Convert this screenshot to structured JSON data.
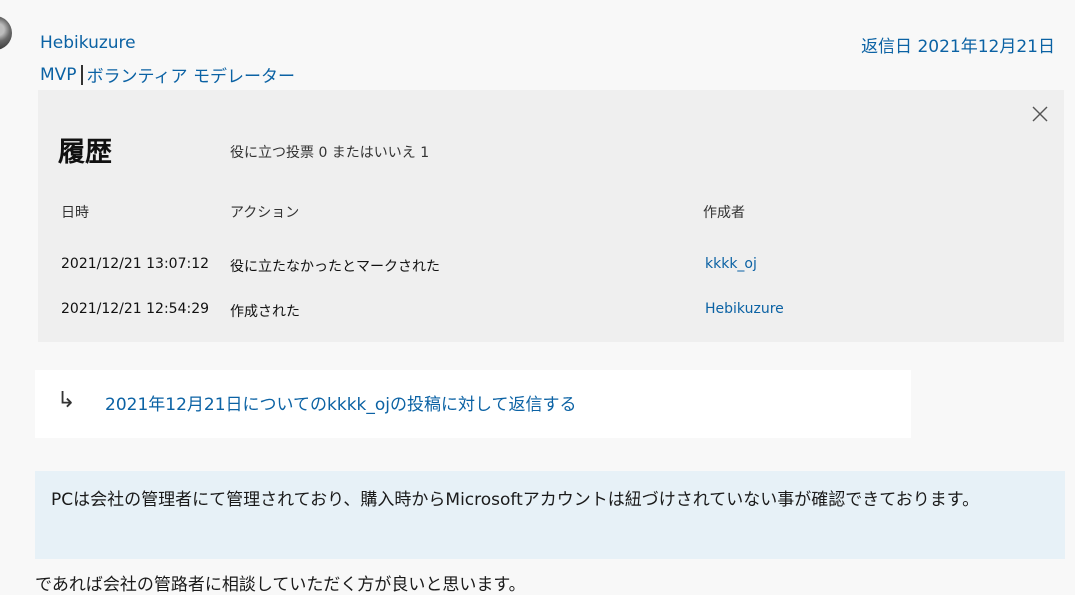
{
  "author": {
    "name": "Hebikuzure",
    "role_prefix": "MVP",
    "role": "ボランティア モデレーター"
  },
  "reply_date": "返信日 2021年12月21日",
  "history": {
    "title": "履歴",
    "votes_summary": "役に立つ投票 0 またはいいえ 1",
    "columns": {
      "datetime": "日時",
      "action": "アクション",
      "author": "作成者"
    },
    "rows": [
      {
        "datetime": "2021/12/21 13:07:12",
        "action": "役に立たなかったとマークされた",
        "author": "kkkk_oj"
      },
      {
        "datetime": "2021/12/21 12:54:29",
        "action": "作成された",
        "author": "Hebikuzure"
      }
    ],
    "close_icon": "close-icon"
  },
  "reply_link": {
    "icon": "reply-arrow-icon",
    "text": "2021年12月21日についてのkkkk_ojの投稿に対して返信する"
  },
  "quote": {
    "text": "PCは会社の管理者にて管理されており、購入時からMicrosoftアカウントは紐づけされていない事が確認できております。"
  },
  "body": {
    "text": "であれば会社の管路者に相談していただく方が良いと思います。"
  }
}
